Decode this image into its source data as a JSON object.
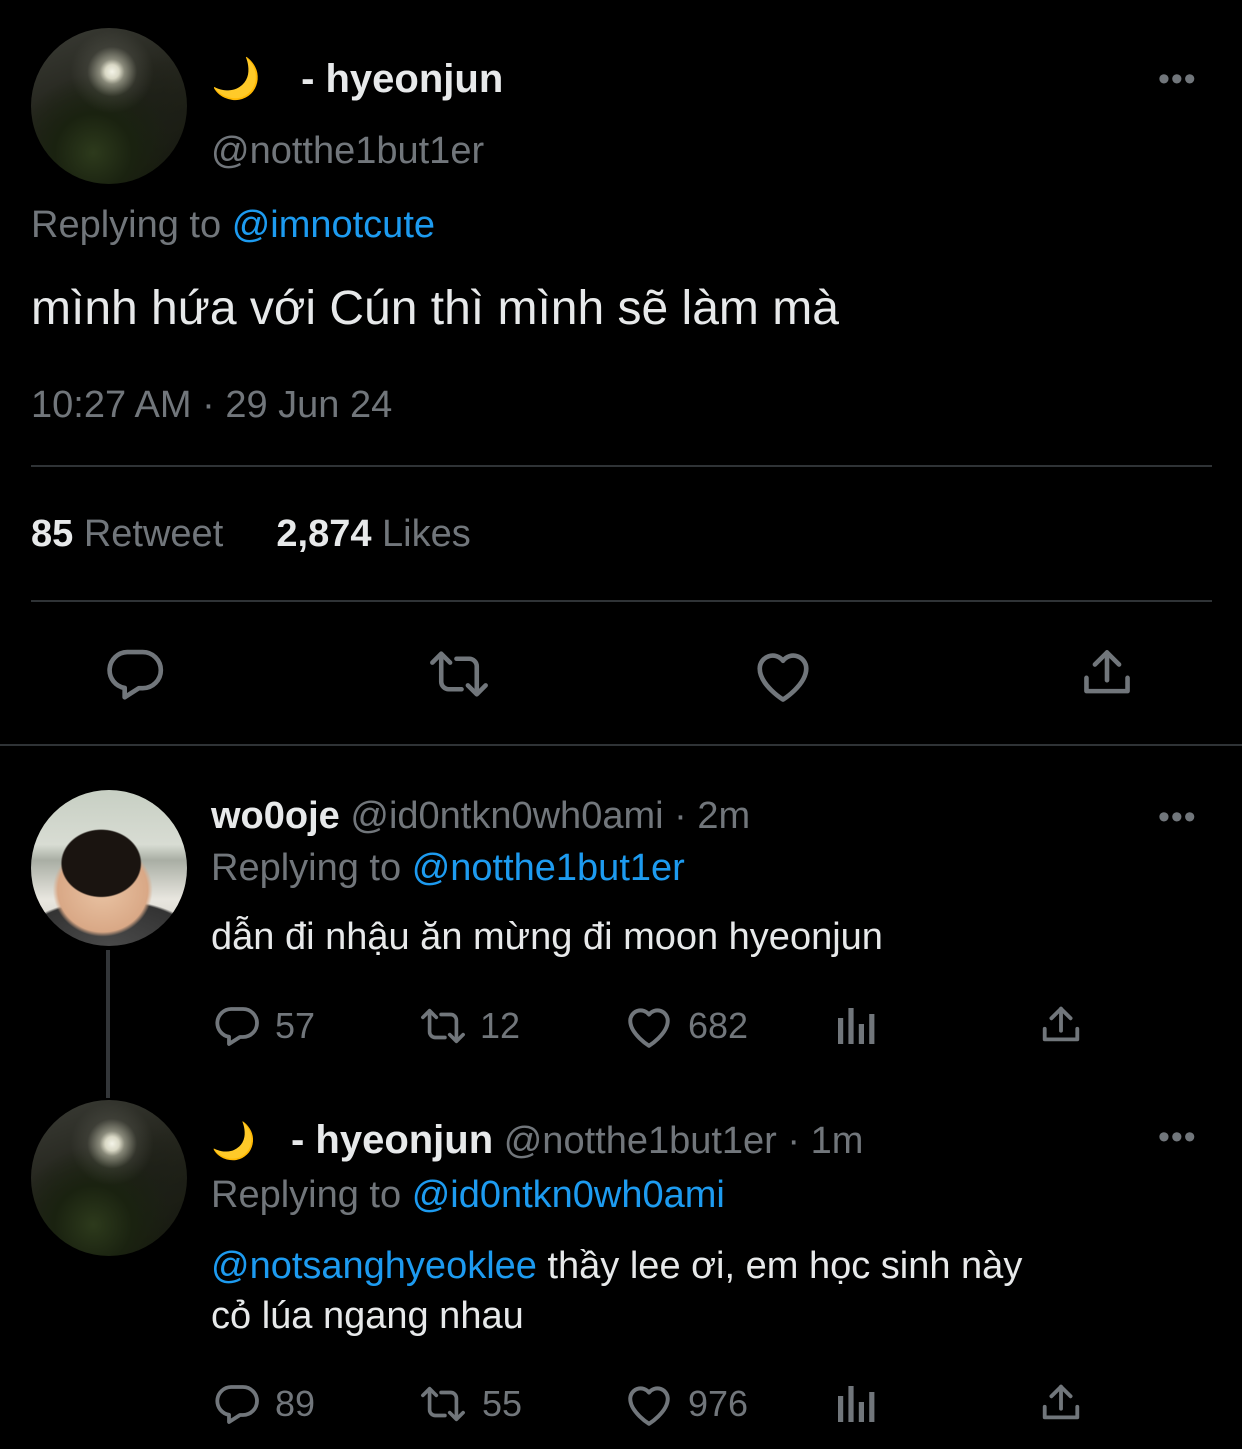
{
  "main_tweet": {
    "emoji": "🌙",
    "display_name": "- hyeonjun",
    "handle": "@notthe1but1er",
    "replying_label": "Replying to",
    "replying_handle": "@imnotcute",
    "text": "mình hứa với Cún thì mình sẽ làm mà",
    "timestamp": "10:27 AM · 29 Jun 24",
    "retweet_count": "85",
    "retweet_label": "Retweet",
    "like_count": "2,874",
    "like_label": "Likes"
  },
  "replies": [
    {
      "display_name": "wo0oje",
      "handle": "@id0ntkn0wh0ami",
      "time": "· 2m",
      "replying_label": "Replying to",
      "replying_handle": "@notthe1but1er",
      "text": "dẫn đi nhậu ăn mừng đi moon hyeonjun",
      "reply_count": "57",
      "retweet_count": "12",
      "like_count": "682"
    },
    {
      "emoji": "🌙",
      "display_name": "- hyeonjun",
      "handle": "@notthe1but1er",
      "time": "· 1m",
      "replying_label": "Replying to",
      "replying_handle": "@id0ntkn0wh0ami",
      "mention": "@notsanghyeoklee",
      "text_line1": "thầy lee ơi, em học sinh này",
      "text_line2": "cỏ lúa ngang nhau",
      "reply_count": "89",
      "retweet_count": "55",
      "like_count": "976"
    }
  ],
  "more_glyph": "•••",
  "colors": {
    "background": "#000000",
    "text": "#e7e9ea",
    "muted": "#71767b",
    "accent": "#1d9bf0",
    "divider": "#2f3336"
  },
  "icons": [
    "reply-icon",
    "retweet-icon",
    "like-icon",
    "share-icon",
    "analytics-icon",
    "more-icon",
    "moon-emoji"
  ]
}
